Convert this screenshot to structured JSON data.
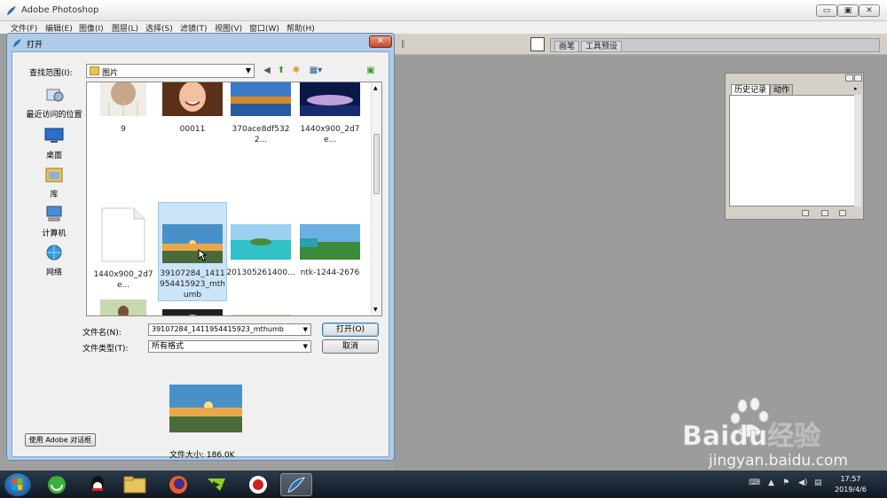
{
  "ps_window": {
    "title": "Adobe Photoshop",
    "minimize_glyph": "▭",
    "maximize_glyph": "▣",
    "close_glyph": "✕"
  },
  "menubar": {
    "items": [
      "文件(F)",
      "编辑(E)",
      "图像(I)",
      "图层(L)",
      "选择(S)",
      "滤镜(T)",
      "视图(V)",
      "窗口(W)",
      "帮助(H)"
    ]
  },
  "toolbar": {
    "palette_well_tabs": [
      "画笔",
      "工具预设"
    ]
  },
  "history_panel": {
    "tabs": [
      "历史记录",
      "动作"
    ],
    "active_tab": "历史记录"
  },
  "open_dialog": {
    "title": "打开",
    "close_glyph": "✕",
    "look_in_label": "查找范围(I):",
    "look_in_value": "图片",
    "places": [
      "最近访问的位置",
      "桌面",
      "库",
      "计算机",
      "网络"
    ],
    "files": [
      {
        "name": "9",
        "thumb": "portrait-collage"
      },
      {
        "name": "00011",
        "thumb": "smiling-girl"
      },
      {
        "name": "370ace8df5322...",
        "thumb": "autumn-lake"
      },
      {
        "name": "1440x900_2d7e...",
        "thumb": "sunset-river"
      },
      {
        "name": "1440x900_2d7e...",
        "thumb": "blank-document"
      },
      {
        "name": "39107284_1411954415923_mthumb",
        "thumb": "sunset-rocks",
        "selected": true
      },
      {
        "name": "201305261400...",
        "thumb": "tropical-island"
      },
      {
        "name": "ntk-1244-2676",
        "thumb": "green-coast"
      },
      {
        "name": "",
        "thumb": "woman-beach"
      },
      {
        "name": "",
        "thumb": "woman-closeup"
      },
      {
        "name": "",
        "thumb": "woman-hat"
      },
      {
        "name": "",
        "thumb": "woman-sky"
      }
    ],
    "filename_label": "文件名(N):",
    "filename_value": "39107284_1411954415923_mthumb",
    "filetype_label": "文件类型(T):",
    "filetype_value": "所有格式",
    "open_button": "打开(O)",
    "cancel_button": "取消",
    "file_size_label": "文件大小: 186.0K",
    "use_adobe_dialog_button": "使用 Adobe 对话框"
  },
  "taskbar": {
    "clock_time": "17:57",
    "clock_date": "2019/4/6"
  },
  "watermark": {
    "brand": "Baidu经验",
    "url": "jingyan.baidu.com"
  },
  "colors": {
    "dialog_frame": "#aecbe8",
    "selection": "#cce4f7",
    "workspace": "#9c9c9c"
  }
}
